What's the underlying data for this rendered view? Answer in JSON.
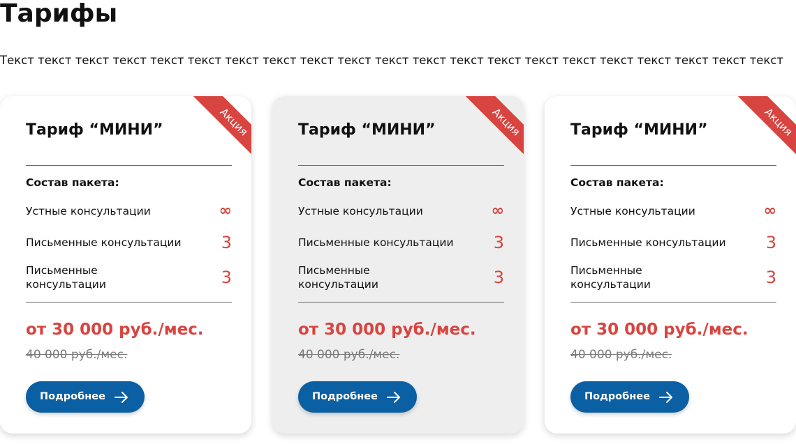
{
  "header": {
    "title": "Тарифы",
    "intro": "Текст текст текст текст текст текст текст текст текст текст текст текст текст текст текст текст текст текст текст текст текст"
  },
  "colors": {
    "accent": "#d8443f",
    "button": "#0b5fa3",
    "highlight_card": "#eeeeee"
  },
  "cards": [
    {
      "ribbon": "Акция",
      "title": "Тариф “МИНИ”",
      "package_heading": "Состав пакета:",
      "features": [
        {
          "label": "Устные консультации",
          "value": "∞"
        },
        {
          "label": "Письменные консультации",
          "value": "3"
        },
        {
          "label": "Письменные консультации",
          "value": "3"
        }
      ],
      "price": "от 30 000 руб./мес.",
      "old_price": "40 000 руб./мес.",
      "button_label": "Подробнее",
      "button_icon": "arrow-right-icon",
      "highlighted": false
    },
    {
      "ribbon": "Акция",
      "title": "Тариф “МИНИ”",
      "package_heading": "Состав пакета:",
      "features": [
        {
          "label": "Устные консультации",
          "value": "∞"
        },
        {
          "label": "Письменные консультации",
          "value": "3"
        },
        {
          "label": "Письменные консультации",
          "value": "3"
        }
      ],
      "price": "от 30 000 руб./мес.",
      "old_price": "40 000 руб./мес.",
      "button_label": "Подробнее",
      "button_icon": "arrow-right-icon",
      "highlighted": true
    },
    {
      "ribbon": "Акция",
      "title": "Тариф “МИНИ”",
      "package_heading": "Состав пакета:",
      "features": [
        {
          "label": "Устные консультации",
          "value": "∞"
        },
        {
          "label": "Письменные консультации",
          "value": "3"
        },
        {
          "label": "Письменные консультации",
          "value": "3"
        }
      ],
      "price": "от 30 000 руб./мес.",
      "old_price": "40 000 руб./мес.",
      "button_label": "Подробнее",
      "button_icon": "arrow-right-icon",
      "highlighted": false
    }
  ]
}
